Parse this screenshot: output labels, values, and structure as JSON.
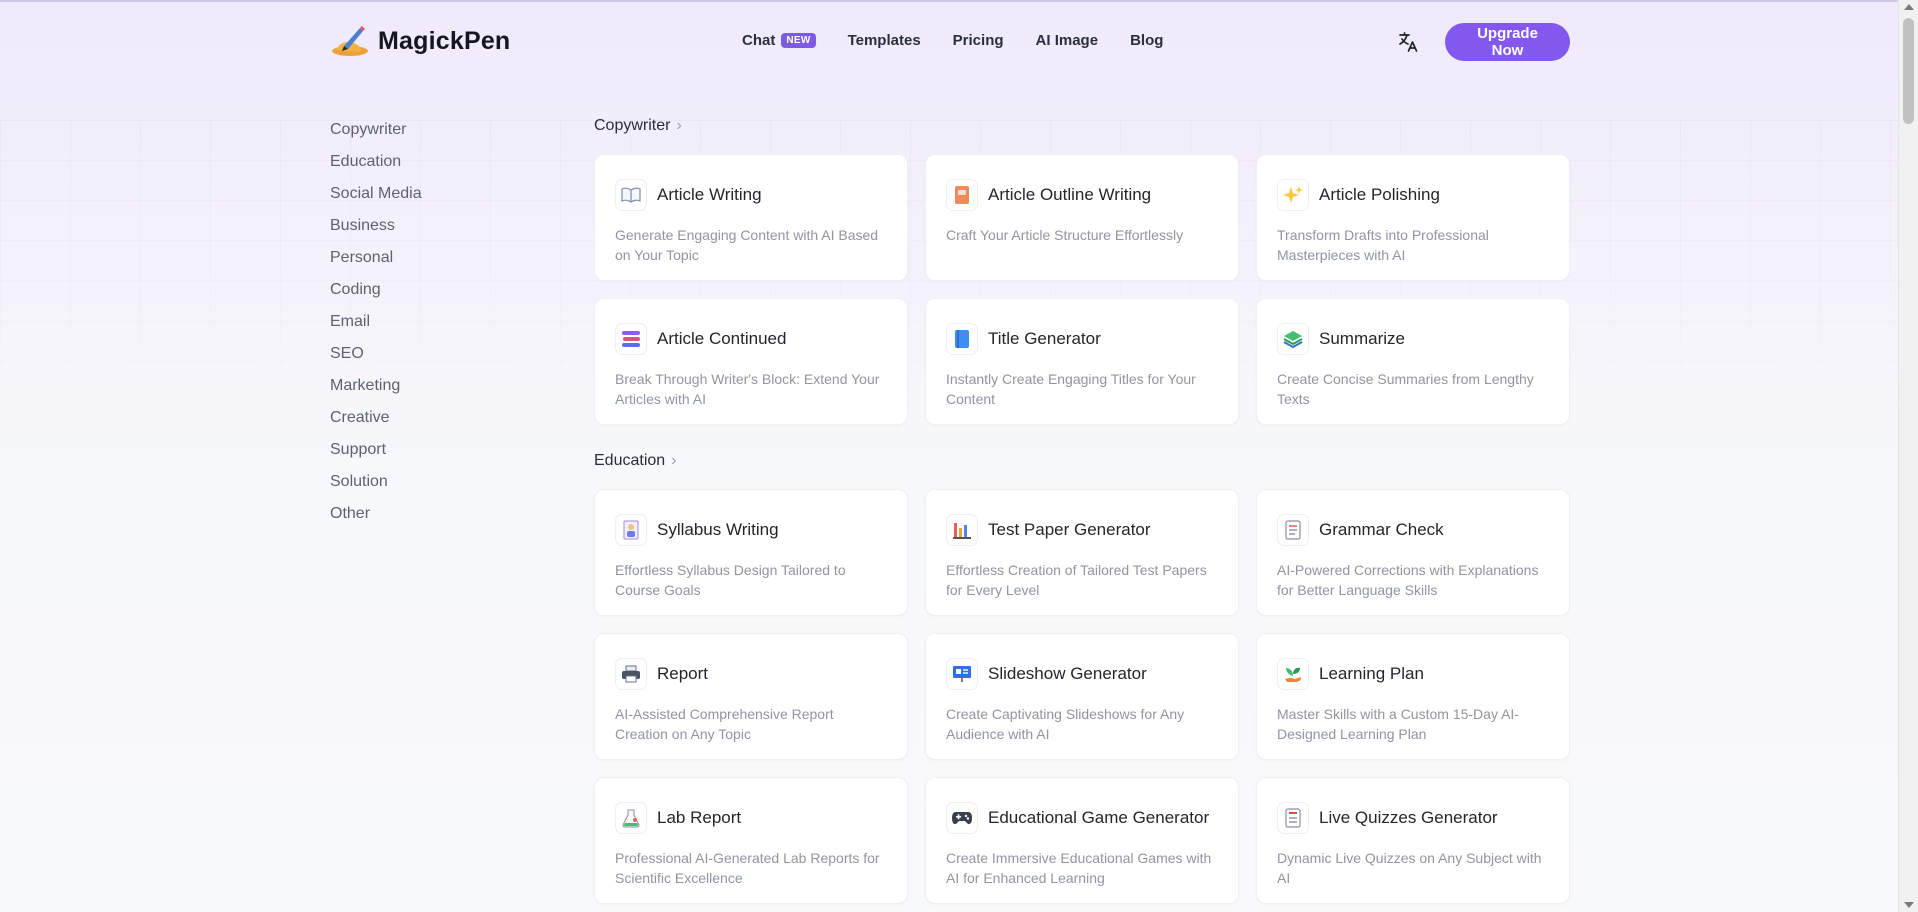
{
  "brand": {
    "name": "MagickPen"
  },
  "nav": {
    "chat": "Chat",
    "chat_badge": "NEW",
    "templates": "Templates",
    "pricing": "Pricing",
    "ai_image": "AI Image",
    "blog": "Blog"
  },
  "header": {
    "upgrade_label": "Upgrade Now",
    "language_icon": "translate-icon"
  },
  "sidebar": {
    "items": [
      {
        "label": "Copywriter"
      },
      {
        "label": "Education"
      },
      {
        "label": "Social Media"
      },
      {
        "label": "Business"
      },
      {
        "label": "Personal"
      },
      {
        "label": "Coding"
      },
      {
        "label": "Email"
      },
      {
        "label": "SEO"
      },
      {
        "label": "Marketing"
      },
      {
        "label": "Creative"
      },
      {
        "label": "Support"
      },
      {
        "label": "Solution"
      },
      {
        "label": "Other"
      }
    ]
  },
  "sections": [
    {
      "title": "Copywriter",
      "cards": [
        {
          "title": "Article Writing",
          "desc": "Generate Engaging Content with AI Based on Your Topic",
          "icon": "open-book-icon"
        },
        {
          "title": "Article Outline Writing",
          "desc": "Craft Your Article Structure Effortlessly",
          "icon": "notebook-icon"
        },
        {
          "title": "Article Polishing",
          "desc": "Transform Drafts into Professional Masterpieces with AI",
          "icon": "sparkles-icon"
        },
        {
          "title": "Article Continued",
          "desc": "Break Through Writer's Block: Extend Your Articles with AI",
          "icon": "books-stack-icon"
        },
        {
          "title": "Title Generator",
          "desc": "Instantly Create Engaging Titles for Your Content",
          "icon": "blue-book-icon"
        },
        {
          "title": "Summarize",
          "desc": "Create Concise Summaries from Lengthy Texts",
          "icon": "layers-icon"
        }
      ]
    },
    {
      "title": "Education",
      "cards": [
        {
          "title": "Syllabus Writing",
          "desc": "Effortless Syllabus Design Tailored to Course Goals",
          "icon": "teacher-icon"
        },
        {
          "title": "Test Paper Generator",
          "desc": "Effortless Creation of Tailored Test Papers for Every Level",
          "icon": "chart-board-icon"
        },
        {
          "title": "Grammar Check",
          "desc": "AI-Powered Corrections with Explanations for Better Language Skills",
          "icon": "checklist-icon"
        },
        {
          "title": "Report",
          "desc": "AI-Assisted Comprehensive Report Creation on Any Topic",
          "icon": "printer-icon"
        },
        {
          "title": "Slideshow Generator",
          "desc": "Create Captivating Slideshows for Any Audience with AI",
          "icon": "presentation-icon"
        },
        {
          "title": "Learning Plan",
          "desc": "Master Skills with a Custom 15-Day AI-Designed Learning Plan",
          "icon": "plant-hand-icon"
        },
        {
          "title": "Lab Report",
          "desc": "Professional AI-Generated Lab Reports for Scientific Excellence",
          "icon": "flask-icon"
        },
        {
          "title": "Educational Game Generator",
          "desc": "Create Immersive Educational Games with AI for Enhanced Learning",
          "icon": "gamepad-icon"
        },
        {
          "title": "Live Quizzes Generator",
          "desc": "Dynamic Live Quizzes on Any Subject with AI",
          "icon": "quiz-sheet-icon"
        }
      ]
    }
  ]
}
